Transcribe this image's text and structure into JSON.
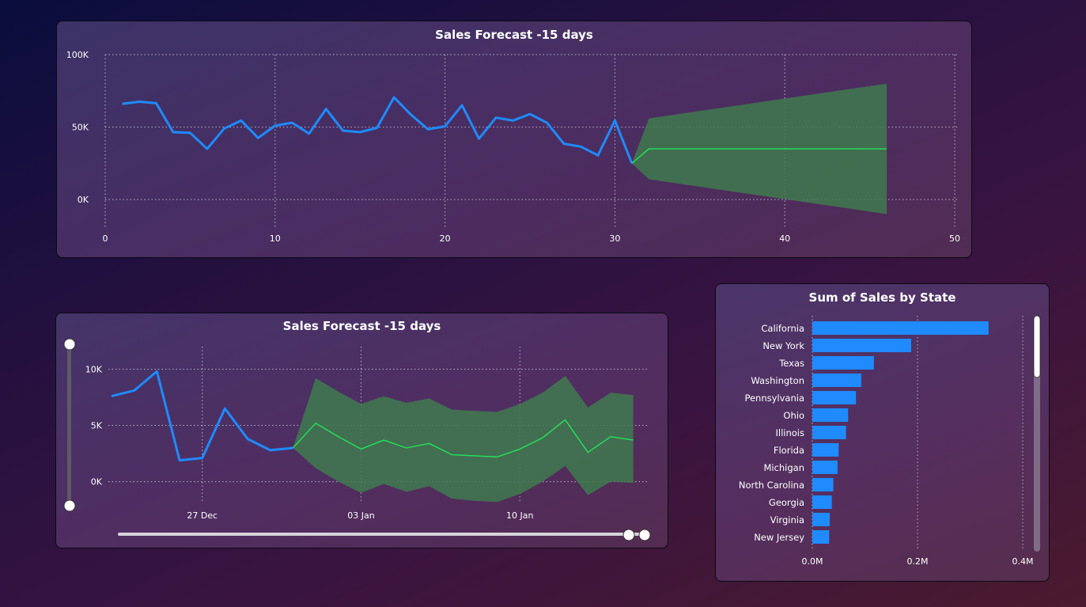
{
  "colors": {
    "actual": "#1f8bff",
    "forecast": "#22e35a",
    "band": "#3f7a4f",
    "bar": "#1f8bff",
    "grid": "#b9b4c8"
  },
  "chart_data": [
    {
      "type": "line",
      "title": "Sales Forecast -15 days",
      "xlim": [
        0,
        50
      ],
      "ylim": [
        -7000,
        100000
      ],
      "x_ticks": [
        0,
        10,
        20,
        30,
        40,
        50
      ],
      "x_tick_labels": [
        "0",
        "10",
        "20",
        "30",
        "40",
        "50"
      ],
      "y_ticks": [
        0,
        50000,
        100000
      ],
      "y_tick_labels": [
        "0K",
        "50K",
        "100K"
      ],
      "grid": true,
      "series": [
        {
          "role": "actual",
          "x": [
            1,
            2,
            3,
            4,
            5,
            6,
            7,
            8,
            9,
            10,
            11,
            12,
            13,
            14,
            15,
            16,
            17,
            18,
            19,
            20,
            21,
            22,
            23,
            24,
            25,
            26,
            27,
            28,
            29,
            30,
            31
          ],
          "y": [
            66000,
            67500,
            66500,
            46500,
            46000,
            35000,
            49000,
            54500,
            42500,
            51000,
            53000,
            45500,
            62500,
            47500,
            46500,
            49500,
            70500,
            58500,
            48500,
            50500,
            65000,
            42000,
            56500,
            54500,
            59000,
            53000,
            38500,
            36500,
            30500,
            54500,
            25000
          ]
        },
        {
          "role": "forecast",
          "x": [
            31,
            32,
            46
          ],
          "y": [
            25000,
            35000,
            35000
          ]
        }
      ],
      "band": {
        "x": [
          31,
          32,
          46
        ],
        "upper": [
          25000,
          56000,
          80000
        ],
        "lower": [
          25000,
          14000,
          -10000
        ]
      }
    },
    {
      "type": "line",
      "title": "Sales Forecast -15 days",
      "x_tick_labels": [
        "27 Dec",
        "03 Jan",
        "10 Jan"
      ],
      "x_ticks": [
        5,
        12,
        19
      ],
      "xlim": [
        1,
        24.5
      ],
      "ylim": [
        -1500,
        12000
      ],
      "y_ticks": [
        0,
        5000,
        10000
      ],
      "y_tick_labels": [
        "0K",
        "5K",
        "10K"
      ],
      "grid": true,
      "series": [
        {
          "role": "actual",
          "x": [
            1,
            2,
            3,
            4,
            5,
            6,
            7,
            8,
            9
          ],
          "y": [
            7600,
            8100,
            9800,
            1900,
            2100,
            6500,
            3800,
            2800,
            3000
          ]
        },
        {
          "role": "forecast",
          "x": [
            9,
            10,
            11,
            12,
            13,
            14,
            15,
            16,
            17,
            18,
            19,
            20,
            21,
            22,
            23,
            24
          ],
          "y": [
            3000,
            5200,
            4000,
            2900,
            3700,
            3000,
            3400,
            2400,
            2300,
            2200,
            2900,
            3900,
            5500,
            2600,
            4000,
            3700
          ]
        }
      ],
      "band": {
        "x": [
          9,
          10,
          11,
          12,
          13,
          14,
          15,
          16,
          17,
          18,
          19,
          20,
          21,
          22,
          23,
          24
        ],
        "upper": [
          3000,
          9200,
          8000,
          6900,
          7600,
          7000,
          7400,
          6400,
          6300,
          6200,
          6900,
          7900,
          9400,
          6600,
          7900,
          7700
        ],
        "lower": [
          3000,
          1200,
          0,
          -1000,
          -200,
          -900,
          -400,
          -1500,
          -1700,
          -1800,
          -1100,
          0,
          1400,
          -1200,
          0,
          -100
        ]
      }
    },
    {
      "type": "bar",
      "orientation": "horizontal",
      "title": "Sum of Sales by State",
      "categories": [
        "California",
        "New York",
        "Texas",
        "Washington",
        "Pennsylvania",
        "Ohio",
        "Illinois",
        "Florida",
        "Michigan",
        "North Carolina",
        "Georgia",
        "Virginia",
        "New Jersey"
      ],
      "values": [
        0.335,
        0.188,
        0.117,
        0.093,
        0.083,
        0.068,
        0.064,
        0.05,
        0.048,
        0.04,
        0.037,
        0.033,
        0.032
      ],
      "unit": "M",
      "xlim": [
        0,
        0.4
      ],
      "x_ticks": [
        0,
        0.2,
        0.4
      ],
      "x_tick_labels": [
        "0.0M",
        "0.2M",
        "0.4M"
      ],
      "grid": true
    }
  ]
}
